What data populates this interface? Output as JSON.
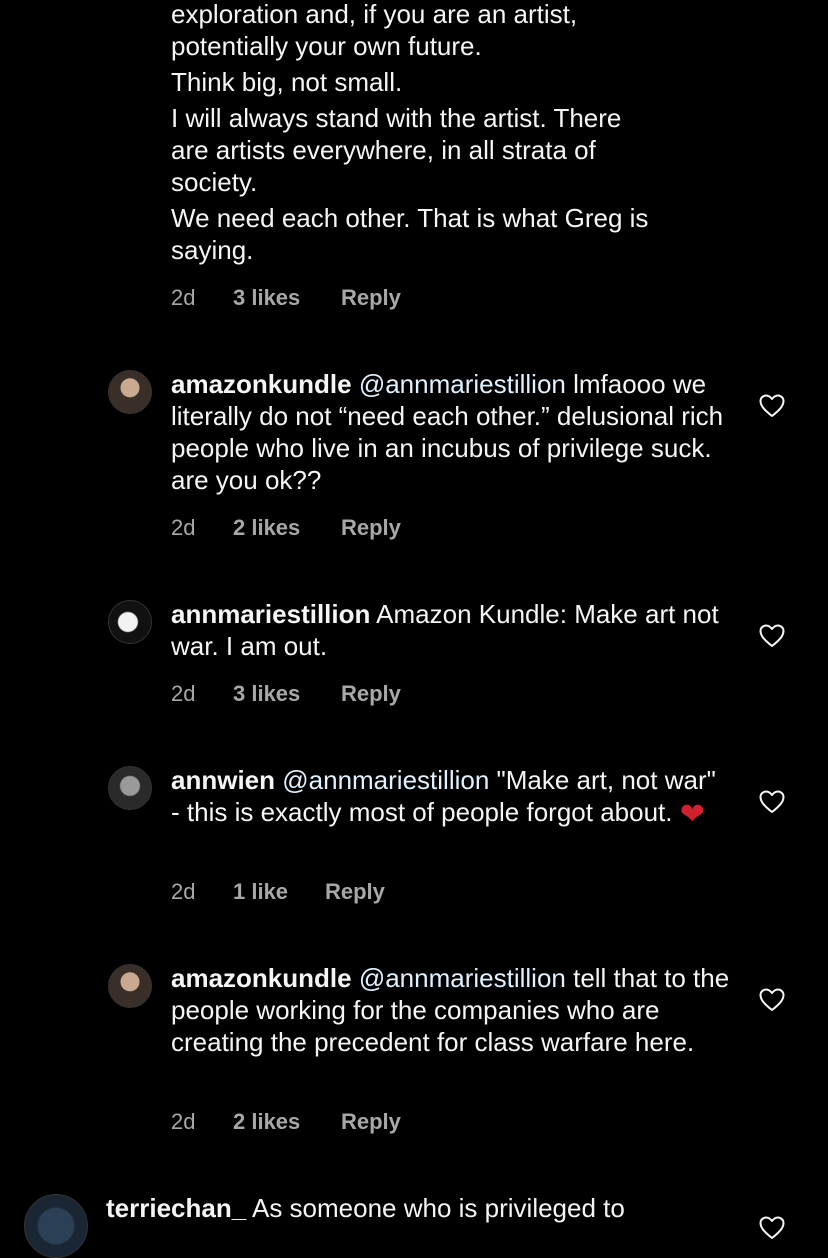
{
  "top_comment": {
    "lines": [
      "exploration and, if you are an artist,",
      "potentially your own future.",
      "Think big, not small.",
      "I will always stand with the artist. There",
      "are artists everywhere, in all strata of",
      "society.",
      "We need each other. That is what Greg is",
      "saying."
    ],
    "time": "2d",
    "likes": "3 likes",
    "reply": "Reply"
  },
  "replies": [
    {
      "username": "amazonkundle",
      "mention": "@annmariestillion",
      "text": " lmfaooo we literally do not “need each other.” delusional rich people who live in an incubus of privilege suck. are you ok??",
      "time": "2d",
      "likes": "2 likes",
      "reply": "Reply"
    },
    {
      "username": "annmariestillion",
      "mention": "",
      "text": " Amazon Kundle: Make art not war. I am out.",
      "time": "2d",
      "likes": "3 likes",
      "reply": "Reply"
    },
    {
      "username": "annwien",
      "mention": "@annmariestillion",
      "text": " \"Make art, not war\" - this is exactly most of people forgot about. ",
      "emoji": "❤",
      "time": "2d",
      "likes": "1 like",
      "reply": "Reply"
    },
    {
      "username": "amazonkundle",
      "mention": "@annmariestillion",
      "text": " tell that to the people working for the companies who are creating the precedent for class warfare here.",
      "time": "2d",
      "likes": "2 likes",
      "reply": "Reply"
    }
  ],
  "bottom_comment": {
    "username": "terriechan_",
    "text": " As someone who is privileged to"
  },
  "icons": {
    "like": "heart-outline-icon"
  },
  "colors": {
    "background": "#000000",
    "text": "#f5f5f5",
    "meta": "#a8a8a8",
    "heart_emoji": "#d1202e"
  }
}
